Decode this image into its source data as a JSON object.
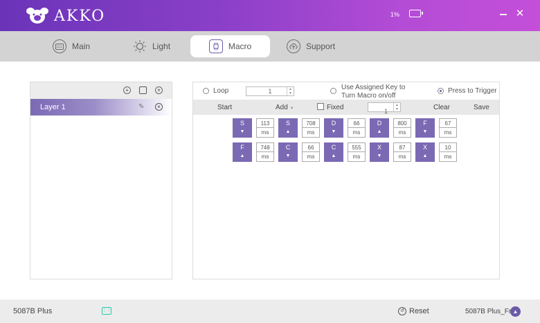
{
  "app": {
    "brand": "AKKO",
    "battery": "1%",
    "close_glyph": "✕"
  },
  "tabs": [
    {
      "label": "Main",
      "icon": "keyboard-icon",
      "active": false
    },
    {
      "label": "Light",
      "icon": "sun-icon",
      "active": false
    },
    {
      "label": "Macro",
      "icon": "chip-icon",
      "active": true
    },
    {
      "label": "Support",
      "icon": "cloud-upload-icon",
      "active": false
    }
  ],
  "layers": {
    "items": [
      {
        "label": "Layer 1",
        "selected": true
      }
    ]
  },
  "macro": {
    "options": {
      "loop_label": "Loop",
      "loop_count": "1",
      "assigned_label": "Use Assigned Key to Turn Macro on/off",
      "press_label": "Press to Trigger",
      "selected": "press"
    },
    "toolbar": {
      "start": "Start",
      "add": "Add",
      "fixed": "Fixed",
      "fixed_value": "1",
      "clear": "Clear",
      "save": "Save"
    },
    "unit": "ms",
    "rows": [
      [
        {
          "key": "S",
          "dir": "down",
          "delay": "113"
        },
        {
          "key": "S",
          "dir": "up",
          "delay": "708"
        },
        {
          "key": "D",
          "dir": "down",
          "delay": "66"
        },
        {
          "key": "D",
          "dir": "up",
          "delay": "800"
        },
        {
          "key": "F",
          "dir": "down",
          "delay": "67"
        }
      ],
      [
        {
          "key": "F",
          "dir": "up",
          "delay": "748"
        },
        {
          "key": "C",
          "dir": "down",
          "delay": "66"
        },
        {
          "key": "C",
          "dir": "up",
          "delay": "555"
        },
        {
          "key": "X",
          "dir": "down",
          "delay": "87"
        },
        {
          "key": "X",
          "dir": "up",
          "delay": "10"
        }
      ]
    ]
  },
  "footer": {
    "model": "5087B Plus",
    "reset_label": "Reset",
    "firmware_model": "5087B Plus_Fn"
  },
  "colors": {
    "accent": "#7b69b4",
    "title_gradient_start": "#6a34b8",
    "title_gradient_end": "#c44fd8",
    "keyboard_icon": "#2bc8a8"
  }
}
